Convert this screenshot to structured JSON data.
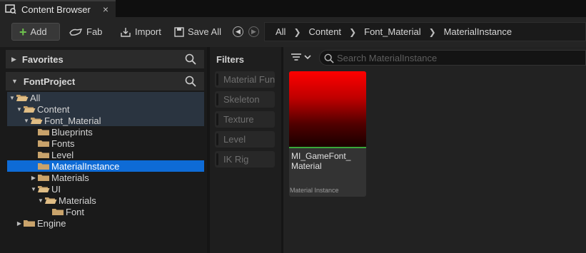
{
  "tab": {
    "title": "Content Browser",
    "close": "×"
  },
  "toolbar": {
    "add_label": "Add",
    "fab_label": "Fab",
    "import_label": "Import",
    "saveall_label": "Save All"
  },
  "breadcrumb": [
    "All",
    "Content",
    "Font_Material",
    "MaterialInstance"
  ],
  "left_panel": {
    "favorites_label": "Favorites",
    "project_label": "FontProject",
    "tree": [
      {
        "label": "All",
        "depth": 0,
        "expanded": true
      },
      {
        "label": "Content",
        "depth": 1,
        "expanded": true
      },
      {
        "label": "Font_Material",
        "depth": 2,
        "expanded": true
      },
      {
        "label": "Blueprints",
        "depth": 3
      },
      {
        "label": "Fonts",
        "depth": 3
      },
      {
        "label": "Level",
        "depth": 3
      },
      {
        "label": "MaterialInstance",
        "depth": 3,
        "selected": true
      },
      {
        "label": "Materials",
        "depth": 3,
        "collapsed": true
      },
      {
        "label": "UI",
        "depth": 3,
        "expanded": true
      },
      {
        "label": "Materials",
        "depth": 4,
        "expanded": true
      },
      {
        "label": "Font",
        "depth": 5
      },
      {
        "label": "Engine",
        "depth": 1,
        "collapsed": true
      }
    ]
  },
  "filters": {
    "title": "Filters",
    "chips": [
      "Material Fun",
      "Skeleton",
      "Texture",
      "Level",
      "IK Rig"
    ]
  },
  "content": {
    "search_placeholder": "Search MaterialInstance",
    "asset": {
      "name": "MI_GameFont_ Material",
      "type": "Material Instance"
    }
  },
  "colors": {
    "selection": "#0e6bd6",
    "add_plus": "#6ec24d",
    "folder": "#c9a36b",
    "asset_bar": "#3aa83a"
  }
}
